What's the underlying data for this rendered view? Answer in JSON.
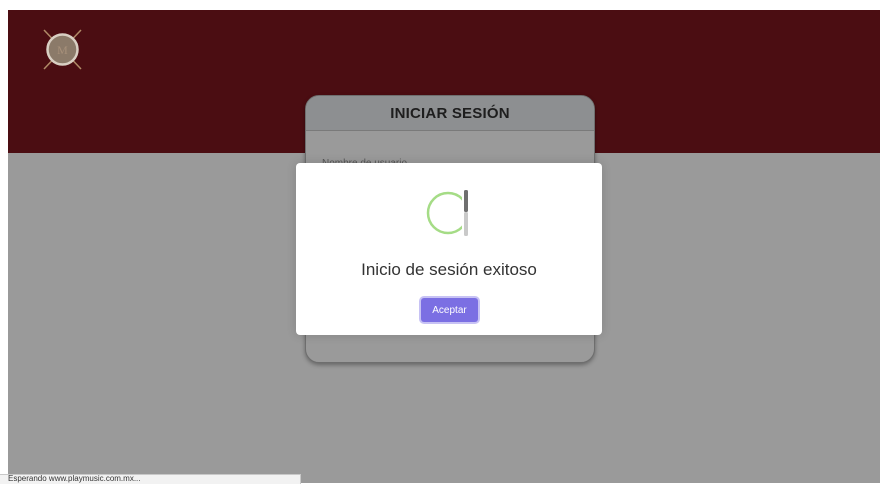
{
  "login_card": {
    "title": "INICIAR SESIÓN",
    "field_label": "Nombre de usuario"
  },
  "modal": {
    "message": "Inicio de sesión exitoso",
    "confirm_label": "Aceptar"
  },
  "status_bar": {
    "text": "Esperando www.playmusic.com.mx..."
  },
  "colors": {
    "header": "#4b0d12",
    "overlay": "#9a9a9a",
    "accent_button": "#7b6fe3",
    "success_ring": "#a5dc86"
  },
  "icons": {
    "logo": "brand-logo",
    "success": "success-check-icon"
  }
}
